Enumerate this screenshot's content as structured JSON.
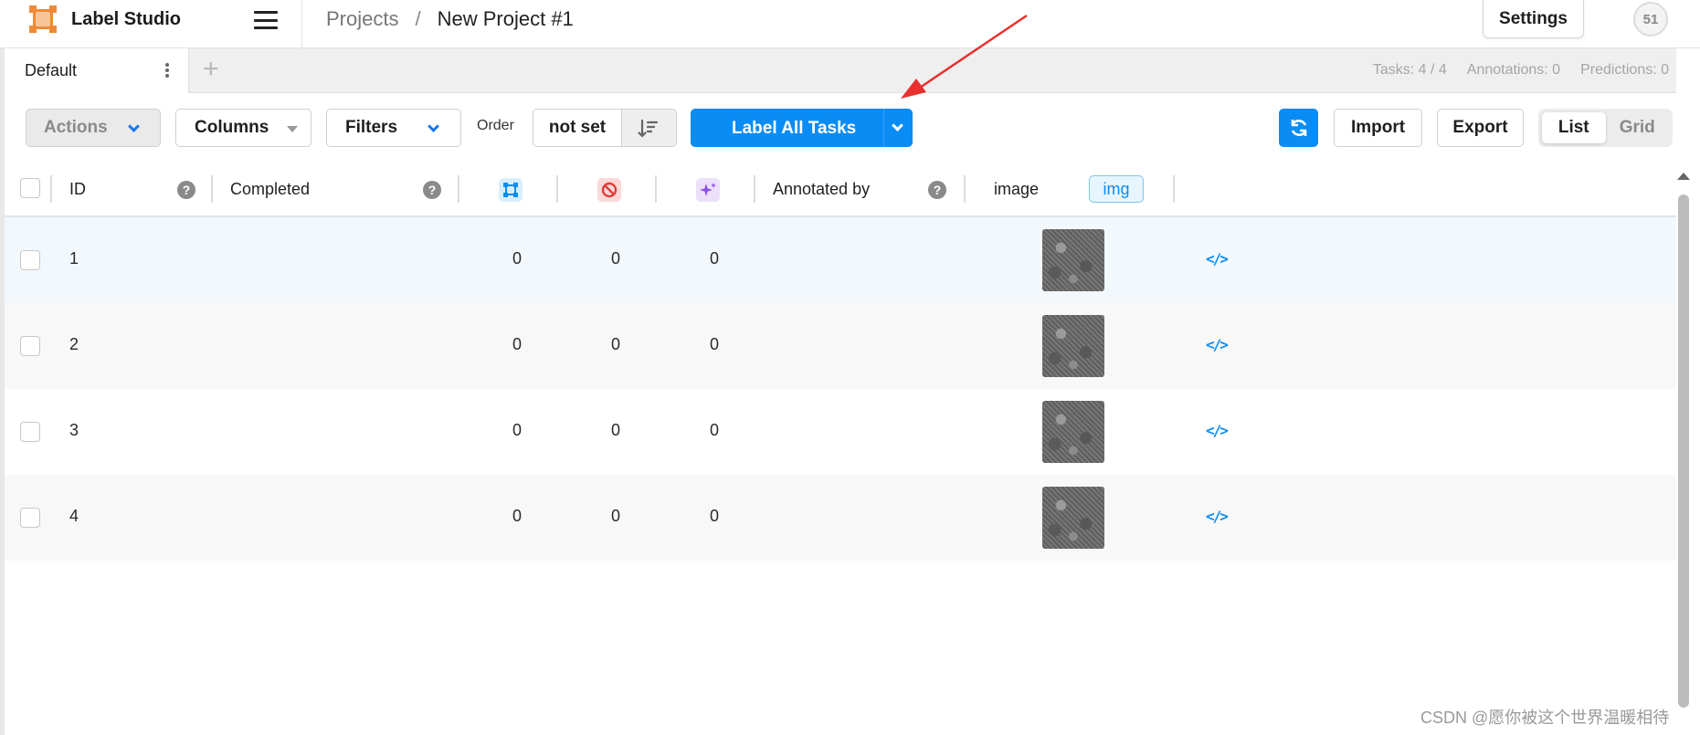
{
  "header": {
    "app_name": "Label Studio",
    "breadcrumb": {
      "projects": "Projects",
      "separator": "/",
      "project": "New Project #1"
    },
    "settings_label": "Settings",
    "avatar_initials": "51"
  },
  "tabs": {
    "items": [
      {
        "label": "Default"
      }
    ],
    "add_symbol": "+"
  },
  "stats": {
    "tasks": "Tasks: 4 / 4",
    "annotations": "Annotations: 0",
    "predictions": "Predictions: 0"
  },
  "toolbar": {
    "actions": "Actions",
    "columns": "Columns",
    "filters": "Filters",
    "order_label": "Order",
    "order_value": "not set",
    "label_all": "Label All Tasks",
    "import": "Import",
    "export": "Export",
    "view_list": "List",
    "view_grid": "Grid",
    "active_view": "List"
  },
  "table": {
    "columns": {
      "id": "ID",
      "completed": "Completed",
      "annotated_by": "Annotated by",
      "image": "image",
      "image_type": "img"
    },
    "column_icons": [
      "annotations-count-icon",
      "cancelled-count-icon",
      "predictions-count-icon"
    ],
    "rows": [
      {
        "id": "1",
        "annotations": "0",
        "cancelled": "0",
        "predictions": "0"
      },
      {
        "id": "2",
        "annotations": "0",
        "cancelled": "0",
        "predictions": "0"
      },
      {
        "id": "3",
        "annotations": "0",
        "cancelled": "0",
        "predictions": "0"
      },
      {
        "id": "4",
        "annotations": "0",
        "cancelled": "0",
        "predictions": "0"
      }
    ]
  },
  "colors": {
    "primary": "#0a8cf5",
    "brand_orange": "#f08a36",
    "annotation_arrow": "#e8302e"
  },
  "watermark": "CSDN @愿你被这个世界温暖相待"
}
